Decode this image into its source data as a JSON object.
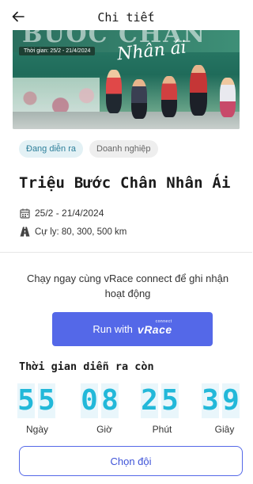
{
  "header": {
    "title": "Chi tiết",
    "back_icon": "arrow-left-icon"
  },
  "banner": {
    "headline": "BƯỚC CHÂN",
    "date_range": "Thời gian: 25/2 - 21/4/2024",
    "script_text": "Nhân ái"
  },
  "tags": [
    {
      "label": "Đang diễn ra"
    },
    {
      "label": "Doanh nghiệp"
    }
  ],
  "event": {
    "name": "Triệu Bước Chân Nhân Ái",
    "date": "25/2 - 21/4/2024",
    "distance": "Cự ly: 80, 300, 500 km",
    "date_icon": "calendar-icon",
    "distance_icon": "road-icon"
  },
  "connect": {
    "description": "Chạy ngay cùng vRace connect để ghi nhận hoạt động",
    "button_label": "Run with",
    "brand": "vRace",
    "brand_sup": "connect"
  },
  "countdown": {
    "label": "Thời gian diễn ra còn",
    "days": [
      "5",
      "5"
    ],
    "hours": [
      "0",
      "8"
    ],
    "minutes": [
      "2",
      "5"
    ],
    "seconds": [
      "3",
      "9"
    ],
    "units": {
      "days": "Ngày",
      "hours": "Giờ",
      "minutes": "Phút",
      "seconds": "Giây"
    }
  },
  "team_button": {
    "label": "Chọn đội"
  },
  "colors": {
    "accent": "#5468e8",
    "digit": "#22b8d9",
    "tag_primary": "#2d7f9a"
  }
}
